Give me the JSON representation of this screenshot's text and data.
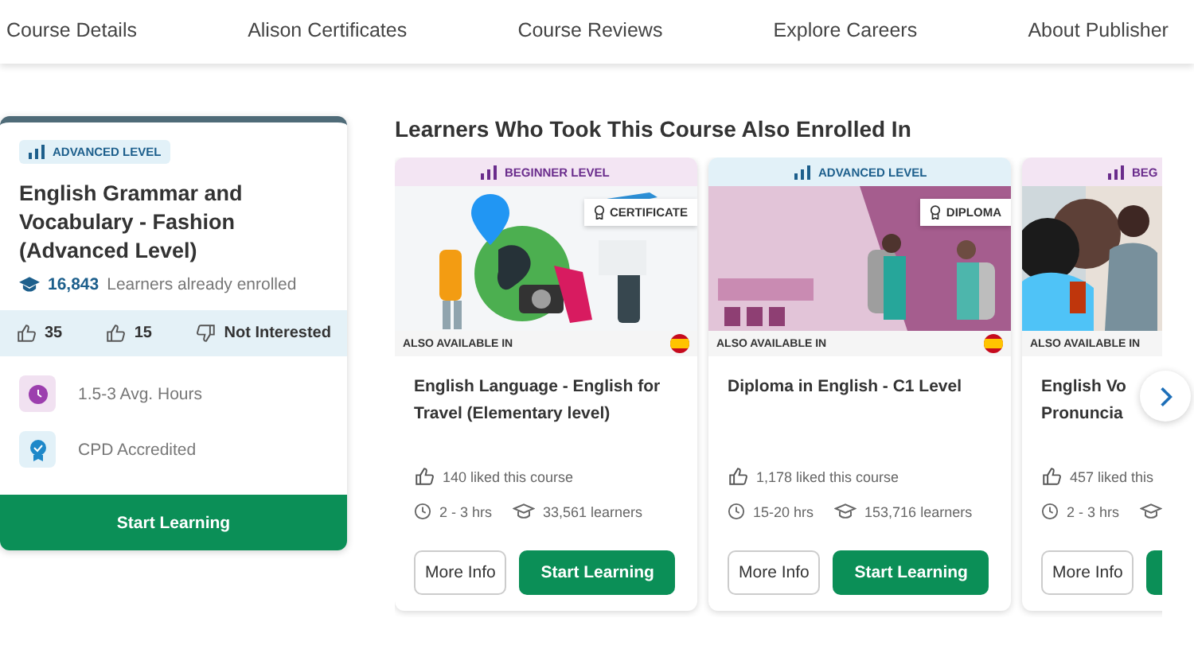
{
  "tabs": [
    {
      "label": "Course Details",
      "selected": false
    },
    {
      "label": "Alison Certificates",
      "selected": false
    },
    {
      "label": "Course Reviews",
      "selected": false
    },
    {
      "label": "Explore Careers",
      "selected": false
    },
    {
      "label": "About Publisher",
      "selected": false
    }
  ],
  "course": {
    "level": {
      "kind": "advanced",
      "label": "ADVANCED LEVEL"
    },
    "title": "English Grammar and Vocabulary - Fashion (Advanced Level)",
    "enrolled_count": "16,843",
    "enrolled_label": "Learners already enrolled",
    "likes": "35",
    "thumbs_up": "15",
    "not_interested": "Not Interested",
    "features": [
      {
        "kind": "hours",
        "label": "1.5-3 Avg. Hours"
      },
      {
        "kind": "cpd",
        "label": "CPD Accredited"
      }
    ],
    "button": "Start Learning"
  },
  "related": {
    "heading": "Learners Who Took This Course Also Enrolled In",
    "cards": [
      {
        "level": {
          "kind": "beginner",
          "label": "BEGINNER LEVEL"
        },
        "image": {
          "kind": "picture"
        },
        "badge": "CERTIFICATE",
        "also_available": "ALSO AVAILABLE IN",
        "flag": true,
        "title": "English Language - English for Travel (Elementary level)",
        "likes": "140 liked this course",
        "hours": "2 - 3 hrs",
        "learners": "33,561 learners",
        "buttons": [
          {
            "kind": "secondary",
            "label": "More Info"
          },
          {
            "kind": "primary",
            "label": "Start Learning"
          }
        ]
      },
      {
        "level": {
          "kind": "advanced",
          "label": "ADVANCED LEVEL"
        },
        "image": {
          "kind": "picture"
        },
        "badge": "DIPLOMA",
        "also_available": "ALSO AVAILABLE IN",
        "flag": true,
        "title": "Diploma in English - C1 Level",
        "likes": "1,178 liked this course",
        "hours": "15-20 hrs",
        "learners": "153,716 learners",
        "buttons": [
          {
            "kind": "secondary",
            "label": "More Info"
          },
          {
            "kind": "primary",
            "label": "Start Learning"
          }
        ]
      },
      {
        "level": {
          "kind": "beginner",
          "label": "BEG"
        },
        "image": {
          "kind": "picture"
        },
        "also_available": "ALSO AVAILABLE IN",
        "flag": false,
        "title": "English Vo\nPronuncia",
        "likes": "457 liked this",
        "hours": "2 - 3 hrs",
        "buttons": [
          {
            "kind": "secondary",
            "label": "More Info"
          },
          {
            "kind": "primary"
          }
        ]
      }
    ]
  }
}
